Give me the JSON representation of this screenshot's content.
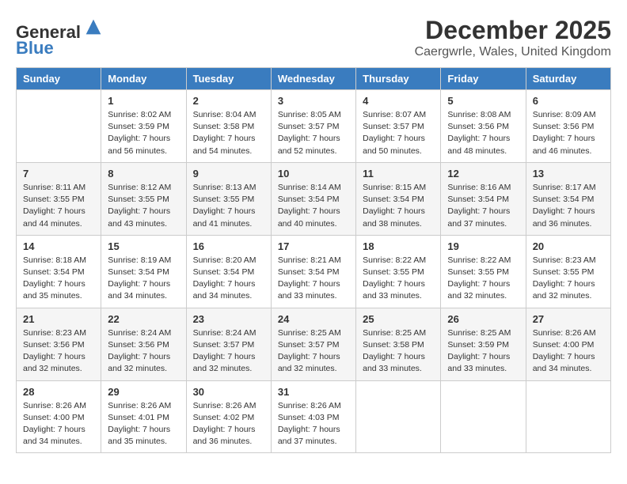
{
  "logo": {
    "general": "General",
    "blue": "Blue"
  },
  "header": {
    "month": "December 2025",
    "location": "Caergwrle, Wales, United Kingdom"
  },
  "weekdays": [
    "Sunday",
    "Monday",
    "Tuesday",
    "Wednesday",
    "Thursday",
    "Friday",
    "Saturday"
  ],
  "weeks": [
    [
      {
        "day": "",
        "info": ""
      },
      {
        "day": "1",
        "info": "Sunrise: 8:02 AM\nSunset: 3:59 PM\nDaylight: 7 hours\nand 56 minutes."
      },
      {
        "day": "2",
        "info": "Sunrise: 8:04 AM\nSunset: 3:58 PM\nDaylight: 7 hours\nand 54 minutes."
      },
      {
        "day": "3",
        "info": "Sunrise: 8:05 AM\nSunset: 3:57 PM\nDaylight: 7 hours\nand 52 minutes."
      },
      {
        "day": "4",
        "info": "Sunrise: 8:07 AM\nSunset: 3:57 PM\nDaylight: 7 hours\nand 50 minutes."
      },
      {
        "day": "5",
        "info": "Sunrise: 8:08 AM\nSunset: 3:56 PM\nDaylight: 7 hours\nand 48 minutes."
      },
      {
        "day": "6",
        "info": "Sunrise: 8:09 AM\nSunset: 3:56 PM\nDaylight: 7 hours\nand 46 minutes."
      }
    ],
    [
      {
        "day": "7",
        "info": "Sunrise: 8:11 AM\nSunset: 3:55 PM\nDaylight: 7 hours\nand 44 minutes."
      },
      {
        "day": "8",
        "info": "Sunrise: 8:12 AM\nSunset: 3:55 PM\nDaylight: 7 hours\nand 43 minutes."
      },
      {
        "day": "9",
        "info": "Sunrise: 8:13 AM\nSunset: 3:55 PM\nDaylight: 7 hours\nand 41 minutes."
      },
      {
        "day": "10",
        "info": "Sunrise: 8:14 AM\nSunset: 3:54 PM\nDaylight: 7 hours\nand 40 minutes."
      },
      {
        "day": "11",
        "info": "Sunrise: 8:15 AM\nSunset: 3:54 PM\nDaylight: 7 hours\nand 38 minutes."
      },
      {
        "day": "12",
        "info": "Sunrise: 8:16 AM\nSunset: 3:54 PM\nDaylight: 7 hours\nand 37 minutes."
      },
      {
        "day": "13",
        "info": "Sunrise: 8:17 AM\nSunset: 3:54 PM\nDaylight: 7 hours\nand 36 minutes."
      }
    ],
    [
      {
        "day": "14",
        "info": "Sunrise: 8:18 AM\nSunset: 3:54 PM\nDaylight: 7 hours\nand 35 minutes."
      },
      {
        "day": "15",
        "info": "Sunrise: 8:19 AM\nSunset: 3:54 PM\nDaylight: 7 hours\nand 34 minutes."
      },
      {
        "day": "16",
        "info": "Sunrise: 8:20 AM\nSunset: 3:54 PM\nDaylight: 7 hours\nand 34 minutes."
      },
      {
        "day": "17",
        "info": "Sunrise: 8:21 AM\nSunset: 3:54 PM\nDaylight: 7 hours\nand 33 minutes."
      },
      {
        "day": "18",
        "info": "Sunrise: 8:22 AM\nSunset: 3:55 PM\nDaylight: 7 hours\nand 33 minutes."
      },
      {
        "day": "19",
        "info": "Sunrise: 8:22 AM\nSunset: 3:55 PM\nDaylight: 7 hours\nand 32 minutes."
      },
      {
        "day": "20",
        "info": "Sunrise: 8:23 AM\nSunset: 3:55 PM\nDaylight: 7 hours\nand 32 minutes."
      }
    ],
    [
      {
        "day": "21",
        "info": "Sunrise: 8:23 AM\nSunset: 3:56 PM\nDaylight: 7 hours\nand 32 minutes."
      },
      {
        "day": "22",
        "info": "Sunrise: 8:24 AM\nSunset: 3:56 PM\nDaylight: 7 hours\nand 32 minutes."
      },
      {
        "day": "23",
        "info": "Sunrise: 8:24 AM\nSunset: 3:57 PM\nDaylight: 7 hours\nand 32 minutes."
      },
      {
        "day": "24",
        "info": "Sunrise: 8:25 AM\nSunset: 3:57 PM\nDaylight: 7 hours\nand 32 minutes."
      },
      {
        "day": "25",
        "info": "Sunrise: 8:25 AM\nSunset: 3:58 PM\nDaylight: 7 hours\nand 33 minutes."
      },
      {
        "day": "26",
        "info": "Sunrise: 8:25 AM\nSunset: 3:59 PM\nDaylight: 7 hours\nand 33 minutes."
      },
      {
        "day": "27",
        "info": "Sunrise: 8:26 AM\nSunset: 4:00 PM\nDaylight: 7 hours\nand 34 minutes."
      }
    ],
    [
      {
        "day": "28",
        "info": "Sunrise: 8:26 AM\nSunset: 4:00 PM\nDaylight: 7 hours\nand 34 minutes."
      },
      {
        "day": "29",
        "info": "Sunrise: 8:26 AM\nSunset: 4:01 PM\nDaylight: 7 hours\nand 35 minutes."
      },
      {
        "day": "30",
        "info": "Sunrise: 8:26 AM\nSunset: 4:02 PM\nDaylight: 7 hours\nand 36 minutes."
      },
      {
        "day": "31",
        "info": "Sunrise: 8:26 AM\nSunset: 4:03 PM\nDaylight: 7 hours\nand 37 minutes."
      },
      {
        "day": "",
        "info": ""
      },
      {
        "day": "",
        "info": ""
      },
      {
        "day": "",
        "info": ""
      }
    ]
  ]
}
